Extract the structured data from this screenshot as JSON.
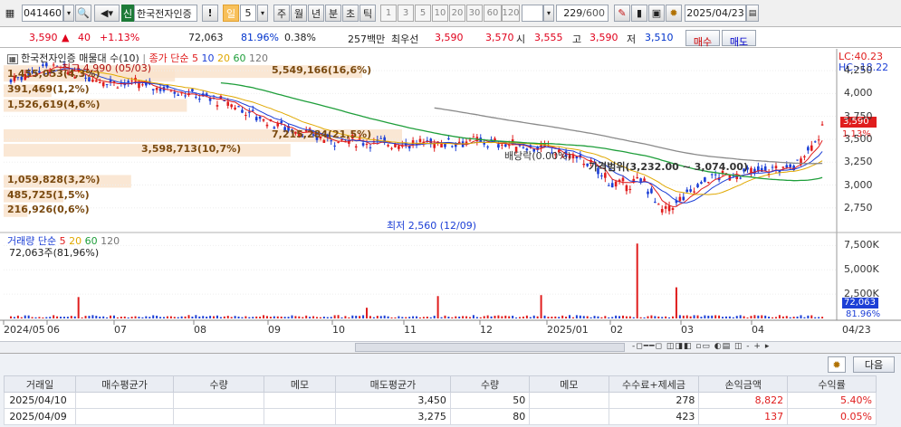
{
  "toolbar": {
    "code": "041460",
    "lock_label": "신",
    "stock_name": "한국전자인증",
    "period_buttons": [
      "일",
      "5",
      "주",
      "월",
      "년",
      "분",
      "초",
      "틱"
    ],
    "active_period": "일",
    "tick_buttons": [
      "1",
      "3",
      "5",
      "10",
      "20",
      "30",
      "60",
      "120"
    ],
    "count": "229",
    "count_total": "/600",
    "date": "2025/04/23"
  },
  "quote": {
    "price": "3,590",
    "change_arrow": "▲",
    "change": "40",
    "change_pct": "+1.13%",
    "volume": "72,063",
    "vol_ratio": "81.96%",
    "turnover": "0.38%",
    "amount": "257백만",
    "best_label": "최우선",
    "ask": "3,590",
    "bid": "3,570",
    "open_label": "시",
    "open": "3,555",
    "high_label": "고",
    "high": "3,590",
    "low_label": "저",
    "low": "3,510",
    "buy_label": "매수",
    "sell_label": "매도"
  },
  "price_panel": {
    "legend_name": "한국전자인증 매물대 수(10)",
    "legend_ma": "종가 단순",
    "ma_periods": [
      "5",
      "10",
      "20",
      "60",
      "120"
    ],
    "ma_colors": {
      "5": "#e01d1d",
      "10": "#1c3fd6",
      "20": "#e0a800",
      "60": "#1e9e3a",
      "120": "#8a8a8a"
    },
    "lc": "LC:40.23",
    "hc": "HC:-18.22",
    "high_note": "최고 4,990 (05/03)",
    "low_note": "최저 2,560 (12/09)",
    "price_tag": "3,590",
    "pct_tag": "1.13%",
    "dividend": "배당락(0.00%)",
    "range_note": "가격범위(3,232.00 ~ 3,074.00)",
    "volume_profile": [
      {
        "label": "1,455,053(4,3%)",
        "price_mid": 4200,
        "share": 0.43
      },
      {
        "label": "391,469(1,2%)",
        "price_mid": 4030,
        "share": 0.12
      },
      {
        "label": "1,526,619(4,6%)",
        "price_mid": 3870,
        "share": 0.46
      },
      {
        "label": "5,549,166(16,6%)",
        "price_mid": 4240,
        "share": 0.9
      },
      {
        "label": "7,215,284(21,5%)",
        "price_mid": 3540,
        "share": 1.0
      },
      {
        "label": "3,598,713(10,7%)",
        "price_mid": 3380,
        "share": 0.72
      },
      {
        "label": "1,059,828(3,2%)",
        "price_mid": 3040,
        "share": 0.32
      },
      {
        "label": "485,725(1,5%)",
        "price_mid": 2880,
        "share": 0.15
      },
      {
        "label": "216,926(0,6%)",
        "price_mid": 2720,
        "share": 0.06
      }
    ],
    "axis_ticks": [
      "4,250",
      "4,000",
      "3,750",
      "3,500",
      "3,250",
      "3,000",
      "2,750"
    ]
  },
  "volume_panel": {
    "legend": "거래량",
    "legend_ma": "단순",
    "ma_periods": [
      "5",
      "20",
      "60",
      "120"
    ],
    "info": "72,063주(81,96%)",
    "axis_ticks": [
      "7,500K",
      "5,000K",
      "2,500K"
    ],
    "tag_volume": "72,063",
    "tag_pct": "81.96%"
  },
  "xaxis": {
    "months": [
      "2024/05",
      "06",
      "07",
      "08",
      "09",
      "10",
      "11",
      "12",
      "2025/01",
      "02",
      "03",
      "04",
      "04/23"
    ]
  },
  "table": {
    "next_label": "다음",
    "headers": [
      "거래일",
      "매수평균가",
      "수량",
      "메모",
      "매도평균가",
      "수량",
      "메모",
      "수수료+제세금",
      "손익금액",
      "수익률"
    ],
    "rows": [
      [
        "2025/04/10",
        "",
        "",
        "",
        "3,450",
        "50",
        "",
        "278",
        "8,822",
        "5.40%"
      ],
      [
        "2025/04/09",
        "",
        "",
        "",
        "3,275",
        "80",
        "",
        "423",
        "137",
        "0.05%"
      ]
    ]
  }
}
